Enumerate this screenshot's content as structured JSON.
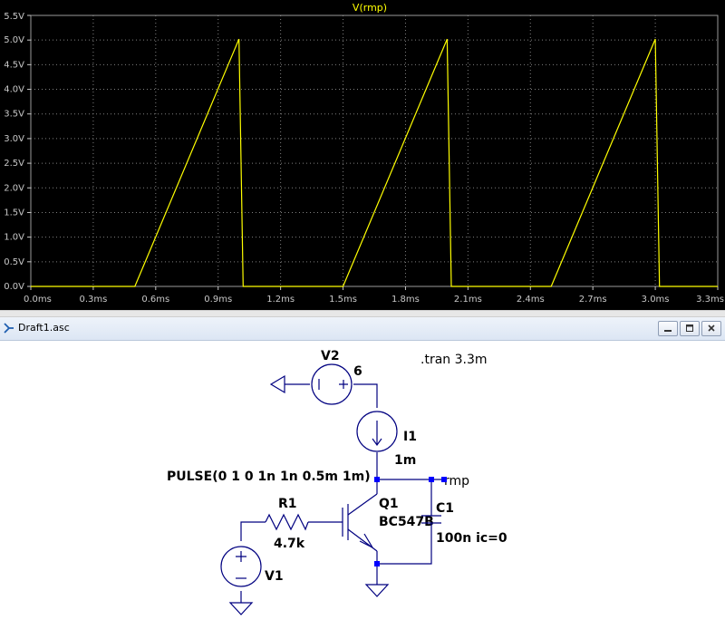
{
  "plot": {
    "trace_name": "V(rmp)",
    "colors": {
      "background": "#000000",
      "trace": "#ffff00",
      "grid": "#808080",
      "ticks": "#c8c8c8"
    },
    "chart_data": {
      "type": "line",
      "title": "V(rmp)",
      "xlabel": "",
      "ylabel": "",
      "xlim": [
        0,
        3.3
      ],
      "ylim": [
        0,
        5.5
      ],
      "grid": true,
      "x_ticks": [
        "0.0ms",
        "0.3ms",
        "0.6ms",
        "0.9ms",
        "1.2ms",
        "1.5ms",
        "1.8ms",
        "2.1ms",
        "2.4ms",
        "2.7ms",
        "3.0ms",
        "3.3ms"
      ],
      "y_ticks": [
        "0.0V",
        "0.5V",
        "1.0V",
        "1.5V",
        "2.0V",
        "2.5V",
        "3.0V",
        "3.5V",
        "4.0V",
        "4.5V",
        "5.0V",
        "5.5V"
      ],
      "series": [
        {
          "name": "V(rmp)",
          "x": [
            0,
            0.5,
            1.0,
            1.02,
            1.5,
            2.0,
            2.02,
            2.5,
            3.0,
            3.02,
            3.3
          ],
          "y": [
            0,
            0,
            5.02,
            0,
            0,
            5.02,
            0,
            0,
            5.02,
            0,
            0
          ]
        }
      ]
    }
  },
  "window": {
    "title": "Draft1.asc",
    "icons": {
      "app": "ltspice-icon",
      "minimize": "minimize-icon",
      "maximize": "maximize-icon",
      "close": "close-icon"
    }
  },
  "schematic": {
    "directive": ".tran 3.3m",
    "v2": {
      "name": "V2",
      "value": "6"
    },
    "i1": {
      "name": "I1",
      "value": "1m"
    },
    "v1": {
      "name": "V1",
      "value": "PULSE(0 1 0 1n 1n 0.5m 1m)"
    },
    "r1": {
      "name": "R1",
      "value": "4.7k"
    },
    "q1": {
      "name": "Q1",
      "value": "BC547B"
    },
    "c1": {
      "name": "C1",
      "value": "100n ic=0"
    },
    "net_label": "rmp",
    "icons": {
      "ground": "ground-icon"
    }
  }
}
